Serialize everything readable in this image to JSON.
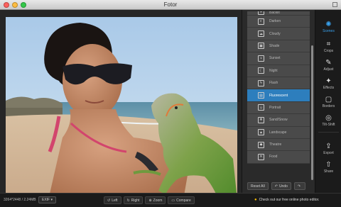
{
  "window": {
    "title": "Fotor"
  },
  "scenes": {
    "items": [
      {
        "label": "Backlit",
        "icon": "☀"
      },
      {
        "label": "Darken",
        "icon": "◐"
      },
      {
        "label": "Cloudy",
        "icon": "☁"
      },
      {
        "label": "Shade",
        "icon": "▣"
      },
      {
        "label": "Sunset",
        "icon": "◒"
      },
      {
        "label": "Night",
        "icon": "☾"
      },
      {
        "label": "Flash",
        "icon": "ϟ"
      },
      {
        "label": "Fluorescent",
        "icon": "▤"
      },
      {
        "label": "Portrait",
        "icon": "☺"
      },
      {
        "label": "Sand/Snow",
        "icon": "❄"
      },
      {
        "label": "Landscape",
        "icon": "▲"
      },
      {
        "label": "Theatre",
        "icon": "◆"
      },
      {
        "label": "Food",
        "icon": "✕"
      }
    ],
    "active": "Fluorescent",
    "reset_label": "Reset All",
    "undo_label": "Undo",
    "redo_label": ""
  },
  "toolbar": {
    "items": [
      {
        "label": "Scenes",
        "icon": "scenes-icon"
      },
      {
        "label": "Crops",
        "icon": "crop-icon"
      },
      {
        "label": "Adjust",
        "icon": "adjust-icon"
      },
      {
        "label": "Effects",
        "icon": "effects-icon"
      },
      {
        "label": "Borders",
        "icon": "borders-icon"
      },
      {
        "label": "Tilt-Shift",
        "icon": "tilt-shift-icon"
      },
      {
        "label": "Export",
        "icon": "export-icon"
      },
      {
        "label": "Share",
        "icon": "share-icon"
      }
    ],
    "active": "Scenes",
    "accent": "#39a3f0"
  },
  "status": {
    "dimensions": "3264*2448 / 2.24MB",
    "exif_label": "EXIF",
    "left_label": "Left",
    "right_label": "Right",
    "zoom_label": "Zoom",
    "compare_label": "Compare",
    "promo_text": "Check out our free online photo editor."
  }
}
